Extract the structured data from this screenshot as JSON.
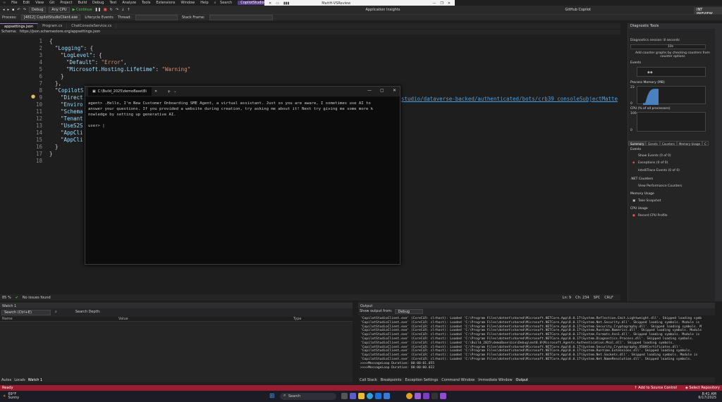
{
  "menu": {
    "items": [
      "File",
      "Edit",
      "View",
      "Git",
      "Project",
      "Build",
      "Debug",
      "Test",
      "Analyze",
      "Tools",
      "Extensions",
      "Window",
      "Help"
    ],
    "search": "Search",
    "solution": "CopilotStudioClient"
  },
  "sharebar": {
    "title": "MattH-VSReview"
  },
  "toolbar": {
    "config": "Debug",
    "platform": "Any CPU",
    "continue": "Continue",
    "app_insights": "Application Insights",
    "copilot": "GitHub Copilot",
    "preview": "INT PREVIEW"
  },
  "processbar": {
    "process_label": "Process:",
    "process_value": "[4812] CopilotStudioClient.exe",
    "lifecycle": "Lifecycle Events",
    "thread": "Thread:",
    "stack": "Stack Frame:"
  },
  "tabs": [
    "appsettings.json",
    "Program.cs",
    "ChatConsoleService.cs"
  ],
  "schema": {
    "label": "Schema:",
    "url": "https://json.schemastore.org/appsettings.json"
  },
  "code": {
    "lines": [
      {
        "n": "1",
        "t": "{"
      },
      {
        "n": "2",
        "k": "\"Logging\"",
        "t": ": {"
      },
      {
        "n": "3",
        "k": "\"LogLevel\"",
        "t": ": {"
      },
      {
        "n": "4",
        "k": "\"Default\"",
        "s": "\"Error\"",
        "t": ","
      },
      {
        "n": "5",
        "k": "\"Microsoft.Hosting.Lifetime\"",
        "s": "\"Warning\""
      },
      {
        "n": "6",
        "t": "}"
      },
      {
        "n": "7",
        "t": "},"
      },
      {
        "n": "8",
        "k": "\"CopilotS"
      },
      {
        "n": "9",
        "k": "\"Direct"
      },
      {
        "n": "10",
        "k": "\"Enviro"
      },
      {
        "n": "11",
        "k": "\"Schema"
      },
      {
        "n": "12",
        "k": "\"Tenant"
      },
      {
        "n": "13",
        "k": "\"UseS2S"
      },
      {
        "n": "14",
        "k": "\"AppCli"
      },
      {
        "n": "15",
        "k": "\"AppCli"
      },
      {
        "n": "16",
        "t": "}"
      },
      {
        "n": "17",
        "t": "}"
      },
      {
        "n": "18",
        "t": ""
      }
    ],
    "link_fragment": "studio/dataverse-backed/authenticated/bots/crb39_consoleSubjectMatte"
  },
  "editor_status": {
    "zoom": "85 %",
    "issues": "No issues found",
    "ln": "Ln: 9",
    "ch": "Ch: 234",
    "spc": "SPC",
    "crlf": "CRLF"
  },
  "terminal": {
    "tab_title": "C:\\Build_2025\\demoBase\\Bi",
    "body": "agent> .Hello, I'm New Customer Onboarding SME Agent, a virtual assistant. Just so you are aware, I sometimes use AI to\nanswer your questions. If you provided a website during creation, try asking me about it! Next try giving me some more k\nnowledge by setting up generative AI.\n\nuser> |"
  },
  "diagnostics": {
    "title": "Diagnostic Tools",
    "session": "Diagnostics session: 8 seconds",
    "time_mark": "10s",
    "hint": "Add counter graphs by checking counters from counter options",
    "events": "Events",
    "process_memory": "Process Memory (MB)",
    "mem_top": "23",
    "mem_bottom": "0",
    "cpu": "CPU (% of all processors)",
    "cpu_top": "100",
    "cpu_bottom": "0",
    "mem_series": [
      0.1,
      0.1,
      0.5,
      0.75,
      0.85,
      0.88,
      0.88,
      0.88
    ],
    "tabs": [
      "Summary",
      "Events",
      "Counters",
      "Memory Usage",
      "C"
    ],
    "sections": {
      "events": "Events",
      "show_events": "Show Events (0 of 0)",
      "exceptions": "Exceptions (0 of 0)",
      "intellitrace": "IntelliTrace Events (0 of 0)",
      "net_counters": ".NET Counters",
      "view_perf": "View Performance Counters",
      "memory": "Memory Usage",
      "snapshot": "Take Snapshot",
      "cpu_usage": "CPU Usage",
      "record_cpu": "Record CPU Profile"
    }
  },
  "watch": {
    "title": "Watch 1",
    "search": "Search (Ctrl+E)",
    "search_depth": "Search Depth:",
    "cols": [
      "Name",
      "Value",
      "Type"
    ],
    "bottom_tabs": [
      "Autos",
      "Locals",
      "Watch 1"
    ]
  },
  "output": {
    "title": "Output",
    "show_from": "Show output from:",
    "source": "Debug",
    "lines": [
      "'CopilotStudioClient.exe' (CoreCLR: clrhost): Loaded 'C:\\Program Files\\dotnet\\shared\\Microsoft.NETCore.App\\8.0.17\\System.Reflection.Emit.Lightweight.dll'. Skipped loading symb",
      "'CopilotStudioClient.exe' (CoreCLR: clrhost): Loaded 'C:\\Program Files\\dotnet\\shared\\Microsoft.NETCore.App\\8.0.17\\System.Net.Security.dll'. Skipped loading symbols. Module is",
      "'CopilotStudioClient.exe' (CoreCLR: clrhost): Loaded 'C:\\Program Files\\dotnet\\shared\\Microsoft.NETCore.App\\8.0.17\\System.Security.Cryptography.dll'. Skipped loading symbols. M",
      "'CopilotStudioClient.exe' (CoreCLR: clrhost): Loaded 'C:\\Program Files\\dotnet\\shared\\Microsoft.NETCore.App\\8.0.17\\System.Runtime.Numerics.dll'. Skipped loading symbols. Module",
      "'CopilotStudioClient.exe' (CoreCLR: clrhost): Loaded 'C:\\Program Files\\dotnet\\shared\\Microsoft.NETCore.App\\8.0.17\\System.Formats.Asn1.dll'. Skipped loading symbols. Module is",
      "'CopilotStudioClient.exe' (CoreCLR: clrhost): Loaded 'C:\\Program Files\\dotnet\\shared\\Microsoft.NETCore.App\\8.0.17\\System.Diagnostics.Process.dll'. Skipped loading symbols.",
      "'CopilotStudioClient.exe' (CoreCLR: clrhost): Loaded 'C:\\Build_2025\\demoBase\\bin\\Debug\\net8.0\\Microsoft.Agents.Authentication.Msal.dll'. Skipped loading symbols.",
      "'CopilotStudioClient.exe' (CoreCLR: clrhost): Loaded 'C:\\Program Files\\dotnet\\shared\\Microsoft.NETCore.App\\8.0.17\\System.Security.Cryptography.X509Certificates.dll'.",
      "'CopilotStudioClient.exe' (CoreCLR: clrhost): Loaded 'C:\\Program Files\\dotnet\\shared\\Microsoft.NETCore.App\\8.0.17\\System.Runtime.Extensions.dll'. Skipped loading symbols.",
      "'CopilotStudioClient.exe' (CoreCLR: clrhost): Loaded 'C:\\Program Files\\dotnet\\shared\\Microsoft.NETCore.App\\8.0.17\\System.Net.Sockets.dll'. Skipped loading symbols. Module is",
      "'CopilotStudioClient.exe' (CoreCLR: clrhost): Loaded 'C:\\Program Files\\dotnet\\shared\\Microsoft.NETCore.App\\8.0.17\\System.Net.NameResolution.dll'. Skipped loading symbols.",
      ">>>>MessageLoop Duration: 00:00:01.055",
      ">>>>MessageLoop Duration: 00:00:00.022"
    ],
    "bottom_tabs": [
      "Call Stack",
      "Breakpoints",
      "Exception Settings",
      "Command Window",
      "Immediate Window",
      "Output"
    ]
  },
  "statusbar": {
    "ready": "Ready",
    "source_control": "Add to Source Control",
    "repository": "Select Repository"
  },
  "taskbar": {
    "weather_temp": "69°F",
    "weather_desc": "Sunny",
    "search": "Search",
    "time": "8:41 AM",
    "date": "6/17/2025"
  }
}
